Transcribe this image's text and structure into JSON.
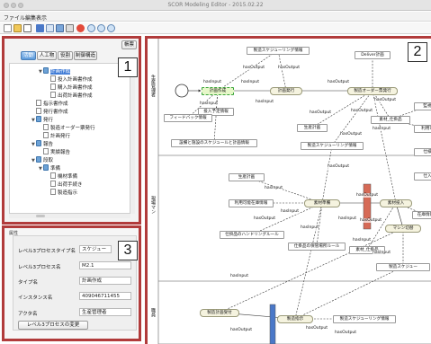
{
  "window": {
    "title": "SCOR Modeling Editor - 2015.02.22"
  },
  "menu": [
    {
      "label": "ファイル"
    },
    {
      "label": "編集"
    },
    {
      "label": "表示"
    }
  ],
  "colors": {
    "annotation_frame": "#b13b3b",
    "tab_selected": "#5c9bdc",
    "selection": "#3f7bd6",
    "node_fill": "#f5f3df",
    "start_node": "#ffffff",
    "sel_node": "#e6f7c9",
    "bar_red": "#d66a56",
    "bar_blue": "#4a78c8"
  },
  "toolbar": {
    "icons": [
      "new-file-icon",
      "open-folder-icon",
      "save-icon",
      "blue-square-icon",
      "grid-icon",
      "blocks-icon",
      "print-icon",
      "delete-icon",
      "zoom-in-icon",
      "zoom-out-icon",
      "settings-icon"
    ]
  },
  "labels": {
    "one": "1",
    "two": "2",
    "three": "3"
  },
  "left_panel": {
    "header_button": "帳票",
    "tabs": [
      {
        "label": "活動",
        "selected": true
      },
      {
        "label": "人工物",
        "selected": false
      },
      {
        "label": "役割",
        "selected": false
      },
      {
        "label": "制御構造",
        "selected": false
      }
    ],
    "tree": [
      {
        "label": "計画作成",
        "depth": 2,
        "kind": "folder",
        "expanded": true,
        "selected": true
      },
      {
        "label": "投入計画書作成",
        "depth": 3,
        "kind": "doc"
      },
      {
        "label": "購入計画書作成",
        "depth": 3,
        "kind": "doc"
      },
      {
        "label": "出荷計画書作成",
        "depth": 3,
        "kind": "doc"
      },
      {
        "label": "指示書作成",
        "depth": 1,
        "kind": "doc"
      },
      {
        "label": "発行書作成",
        "depth": 1,
        "kind": "doc"
      },
      {
        "label": "発行",
        "depth": 1,
        "kind": "folder",
        "expanded": true
      },
      {
        "label": "製造オーダー票発行",
        "depth": 2,
        "kind": "doc"
      },
      {
        "label": "計画発行",
        "depth": 2,
        "kind": "doc"
      },
      {
        "label": "報告",
        "depth": 1,
        "kind": "folder",
        "expanded": true
      },
      {
        "label": "実績報告",
        "depth": 2,
        "kind": "doc"
      },
      {
        "label": "段取",
        "depth": 1,
        "kind": "folder",
        "expanded": true
      },
      {
        "label": "準備",
        "depth": 2,
        "kind": "folder",
        "expanded": true
      },
      {
        "label": "機材準備",
        "depth": 3,
        "kind": "doc"
      },
      {
        "label": "出荷手続き",
        "depth": 3,
        "kind": "doc"
      },
      {
        "label": "製造指示",
        "depth": 3,
        "kind": "doc"
      }
    ]
  },
  "properties": {
    "header": "属性",
    "rows": [
      {
        "label": "レベル3プロセスタイプ名",
        "value": "スケジュー"
      },
      {
        "label": "レベル3プロセス名",
        "value": "M2.1"
      },
      {
        "label": "タイプ名",
        "value": "計画作成"
      },
      {
        "label": "インスタンス名",
        "value": "409046711455"
      },
      {
        "label": "アクタ名",
        "value": "生産管理者"
      }
    ],
    "change_button": "レベル3プロセスの変更"
  },
  "diagram": {
    "lanes": [
      {
        "label": "生産管理者"
      },
      {
        "label": "現場マン"
      },
      {
        "label": "職員"
      }
    ],
    "nodes": [
      {
        "text": "製造スケジューリング情報"
      },
      {
        "text": "Deliver計画"
      },
      {
        "text": "計画作成"
      },
      {
        "text": "計画発行"
      },
      {
        "text": "製造オーダー票発行"
      },
      {
        "text": "投入予定情報"
      },
      {
        "text": "フィードバック情報"
      },
      {
        "text": "生産計画"
      },
      {
        "text": "素材_仕掛品"
      },
      {
        "text": "設備と施設のスケジュールと計画情報"
      },
      {
        "text": "製造スケジューリング情報"
      },
      {
        "text": "仕入"
      },
      {
        "text": "生産計画"
      },
      {
        "text": "利用可能在庫情報"
      },
      {
        "text": "素材準備"
      },
      {
        "text": "素材投入"
      },
      {
        "text": "在庫情報"
      },
      {
        "text": "仕掛品のハンドリングルール"
      },
      {
        "text": "仕掛品の保管場所ルール"
      },
      {
        "text": "素材_仕掛品"
      },
      {
        "text": "マシン切替"
      },
      {
        "text": "製造スケジュー"
      },
      {
        "text": "製造計画受付"
      },
      {
        "text": "製造指示"
      },
      {
        "text": "製造スケジューリング情報"
      },
      {
        "text": "監視"
      },
      {
        "text": "利用可"
      },
      {
        "text": "仕様"
      }
    ],
    "edge_labels": [
      "hasOutput",
      "hasOutput",
      "hasInput",
      "hasInput",
      "hasOutput",
      "hasInput",
      "hasInput",
      "hasOutput",
      "hasOutput",
      "hasOutput",
      "hasOutput",
      "hasInput",
      "hasOutput",
      "hasInput",
      "hasInput",
      "hasOutput",
      "hasInput",
      "hasOutput",
      "hasInput",
      "hasOutput",
      "hasInput",
      "hasInput",
      "hasOutput",
      "hasOutput",
      "hasOutput",
      "hasInput"
    ]
  }
}
